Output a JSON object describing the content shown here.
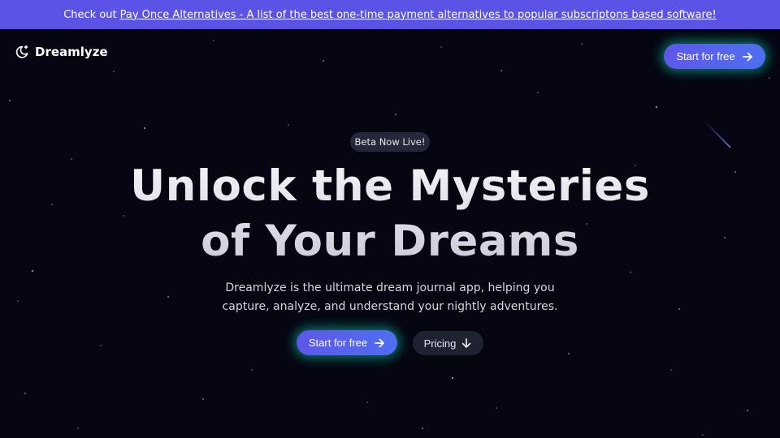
{
  "banner": {
    "prefix": "Check out",
    "link_text": "Pay Once Alternatives - A list of the best one-time payment alternatives to popular subscriptons based software!"
  },
  "nav": {
    "logo_text": "Dreamlyze",
    "cta_label": "Start for free"
  },
  "hero": {
    "badge": "Beta Now Live!",
    "title_line1": "Unlock the Mysteries",
    "title_line2": "of Your Dreams",
    "subtitle": "Dreamlyze is the ultimate dream journal app, helping you capture, analyze, and understand your nightly adventures.",
    "primary_cta": "Start for free",
    "secondary_cta": "Pricing"
  },
  "icons": {
    "logo": "moon-sparkle-icon",
    "nav_cta": "arrow-right-icon",
    "hero_cta": "arrow-right-icon",
    "secondary_cta": "arrow-down-icon"
  },
  "colors": {
    "background": "#050611",
    "banner": "#5b53e6",
    "button_gradient_start": "#5f57e8",
    "button_gradient_end": "#4e6ff0",
    "button_glow": "#10ddbe",
    "secondary_button": "#1f2230"
  }
}
